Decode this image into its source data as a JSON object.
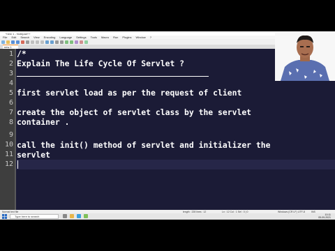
{
  "window": {
    "title": "*new 1 - Notepad++",
    "controls": [
      "–",
      "□",
      "×"
    ]
  },
  "menu": [
    "File",
    "Edit",
    "Search",
    "View",
    "Encoding",
    "Language",
    "Settings",
    "Tools",
    "Macro",
    "Run",
    "Plugins",
    "Window",
    "?"
  ],
  "tab": {
    "label": "new 1"
  },
  "gutter": {
    "lines": [
      "1",
      "2",
      "3",
      "4",
      "5",
      "6",
      "7",
      "8",
      "9",
      "10",
      "11",
      "12"
    ]
  },
  "code": {
    "l1": "/*",
    "l2": "Explain The Life Cycle Of Servlet ?",
    "l5": "first servlet load as per the request of client",
    "l7": "create the object of servlet class by the servlet",
    "l8": "container .",
    "l10": "call the init() method of servlet and initializer the",
    "l11": "servlet"
  },
  "status": {
    "filetype": "Normal text file",
    "length": "length : 228   lines : 12",
    "position": "Ln : 12   Col : 1   Sel : 0 | 0",
    "eol": "Windows (CR LF)",
    "encoding": "UTF-8",
    "mode": "INS"
  },
  "taskbar": {
    "search_placeholder": "Type here to search",
    "time": "10:11",
    "date": "05-09-2021"
  },
  "colors": {
    "editor_bg": "#1b1b36",
    "gutter_bg": "#3e3e3e",
    "accent_tab": "#f28c28"
  }
}
